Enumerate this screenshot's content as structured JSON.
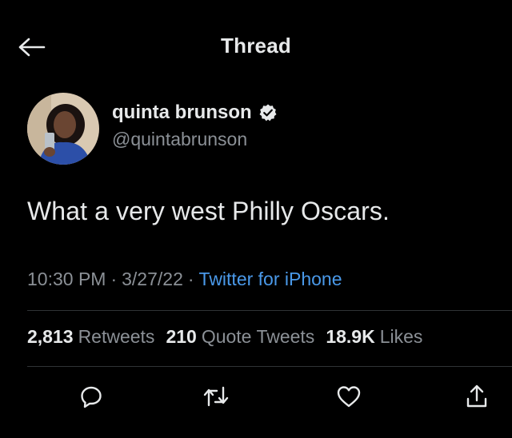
{
  "header": {
    "title": "Thread"
  },
  "author": {
    "display_name": "quinta brunson",
    "handle": "@quintabrunson",
    "verified": true
  },
  "tweet": {
    "text": "What a very west Philly Oscars.",
    "time": "10:30 PM",
    "date": "3/27/22",
    "separator": "·",
    "source": "Twitter for iPhone"
  },
  "stats": {
    "retweets_count": "2,813",
    "retweets_label": "Retweets",
    "quotes_count": "210",
    "quotes_label": "Quote Tweets",
    "likes_count": "18.9K",
    "likes_label": "Likes"
  },
  "icons": {
    "back": "arrow-left-icon",
    "verified": "verified-badge-icon",
    "reply": "reply-icon",
    "retweet": "retweet-icon",
    "like": "heart-icon",
    "share": "share-icon"
  },
  "colors": {
    "background": "#000000",
    "text": "#e7e9ea",
    "muted": "#8b9096",
    "link": "#4a99e9",
    "divider": "#2f3336"
  }
}
